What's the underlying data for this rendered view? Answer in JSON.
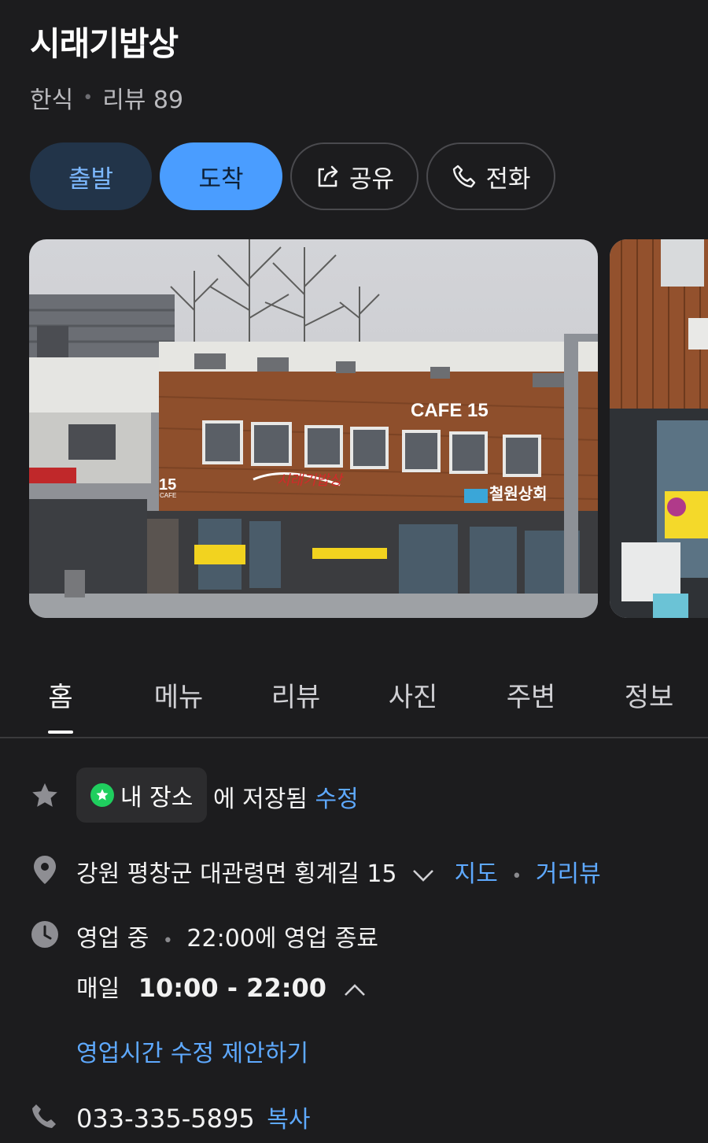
{
  "place": {
    "name": "시래기밥상",
    "category": "한식",
    "review_label": "리뷰 89"
  },
  "actions": {
    "depart": "출발",
    "arrive": "도착",
    "share": "공유",
    "call": "전화"
  },
  "photos": {
    "sign_cafe": "CAFE 15",
    "sign_15": "15",
    "sign_cafe_small": "CAFE",
    "sign_shop": "철원상회"
  },
  "tabs": [
    "홈",
    "메뉴",
    "리뷰",
    "사진",
    "주변",
    "정보"
  ],
  "saved": {
    "chip_label": "내 장소",
    "suffix": "에 저장됨",
    "edit": "수정"
  },
  "address": {
    "text": "강원 평창군 대관령면 횡계길 15",
    "map": "지도",
    "streetview": "거리뷰"
  },
  "hours": {
    "status": "영업 중",
    "closing": "22:00에 영업 종료",
    "days": "매일",
    "range": "10:00 - 22:00",
    "suggest_edit": "영업시간 수정 제안하기"
  },
  "phone": {
    "number": "033-335-5895",
    "copy": "복사"
  },
  "colors": {
    "background": "#1c1c1e",
    "accent_blue": "#4a9dff",
    "link_blue": "#5ea9ff",
    "green": "#1fce5e"
  }
}
